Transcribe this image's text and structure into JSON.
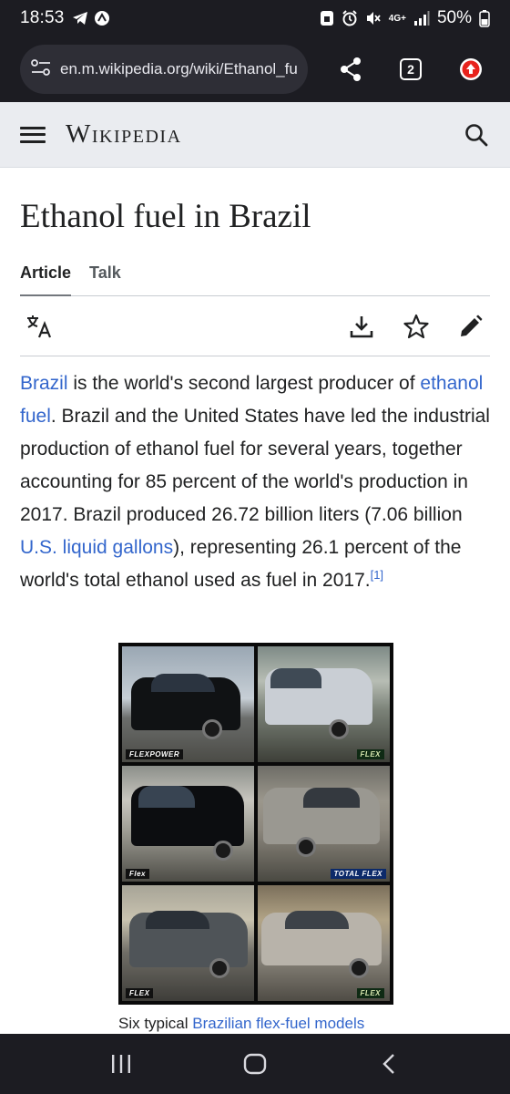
{
  "status_bar": {
    "time": "18:53",
    "network": "4G+",
    "battery": "50%"
  },
  "browser": {
    "url": "en.m.wikipedia.org/wiki/Ethanol_fue",
    "tab_count": "2"
  },
  "wiki": {
    "wordmark": "Wikipedia",
    "title": "Ethanol fuel in Brazil",
    "tabs": [
      "Article",
      "Talk"
    ],
    "lead": {
      "link_brazil": "Brazil",
      "t1": " is the world's second largest producer of ",
      "link_ethanol": "ethanol fuel",
      "t2": ". Brazil and the United States have led the industrial production of ethanol fuel for several years, together accounting for 85 percent of the world's production in 2017. Brazil produced 26.72 billion liters (7.06 billion ",
      "link_gallons": "U.S. liquid gallons",
      "t3": "), representing 26.1 percent of the world's total ethanol used as fuel in 2017.",
      "ref": "[1]"
    },
    "figure": {
      "badges": [
        "FLEXPOWER",
        "FLEX",
        "Flex",
        "TOTAL FLEX",
        "FLEX",
        "FLEX"
      ],
      "caption_prefix": "Six typical ",
      "caption_link": "Brazilian flex-fuel models"
    }
  },
  "colors": {
    "link": "#3366cc",
    "header_bg": "#eaecf0",
    "system_bg": "#1c1c22",
    "update_button": "#e8231d"
  }
}
